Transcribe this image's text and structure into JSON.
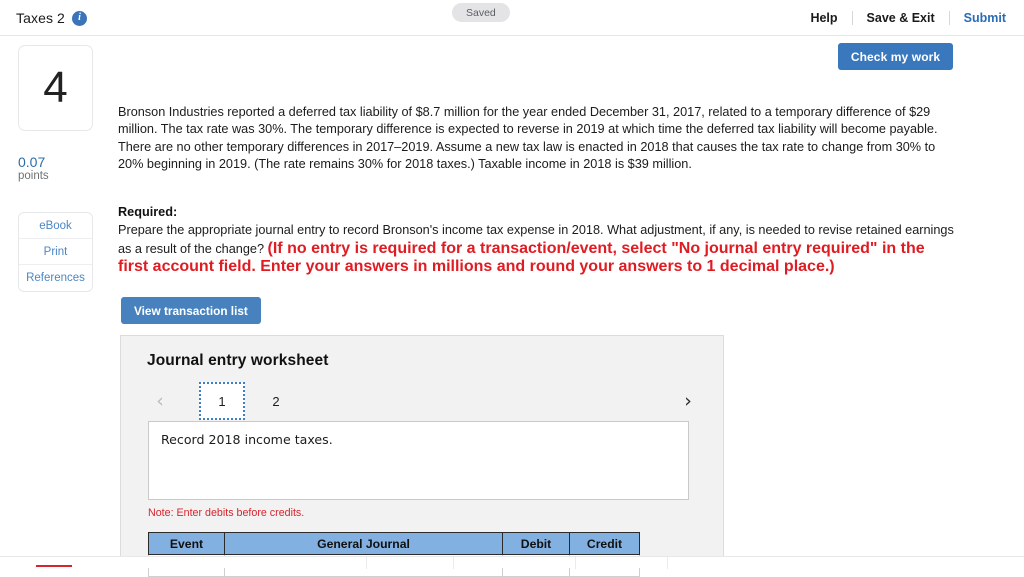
{
  "topbar": {
    "title": "Taxes 2",
    "info_icon": "info-icon",
    "status_pill": "Saved",
    "nav": [
      {
        "label": "Help",
        "style": "dark"
      },
      {
        "label": "Save & Exit",
        "style": "dark"
      },
      {
        "label": "Submit",
        "style": "blue"
      }
    ]
  },
  "actions": {
    "check_my_work": "Check my work",
    "view_transaction_list": "View transaction list"
  },
  "left_rail": {
    "question_number": "4",
    "points_value": "0.07",
    "points_label": "points",
    "buttons": [
      {
        "label": "eBook"
      },
      {
        "label": "Print"
      },
      {
        "label": "References"
      }
    ]
  },
  "question": {
    "body": "Bronson Industries reported a deferred tax liability of $8.7 million for the year ended December 31, 2017, related to a temporary difference of $29 million. The tax rate was 30%. The temporary difference is expected to reverse in 2019 at which time the deferred tax liability will become payable. There are no other temporary differences in 2017–2019. Assume a new tax law is enacted in 2018 that causes the tax rate to change from 30% to 20% beginning in 2019. (The rate remains 30% for 2018 taxes.) Taxable income in 2018 is $39 million.",
    "required_label": "Required:",
    "required_body": "Prepare the appropriate journal entry to record Bronson's income tax expense in 2018. What adjustment, if any, is needed to revise retained earnings as a result of the change? ",
    "required_emphasis": "(If no entry is required for a transaction/event, select \"No journal entry required\" in the first account field. Enter your answers in millions and round your answers to 1 decimal place.)"
  },
  "worksheet": {
    "title": "Journal entry worksheet",
    "prev_icon": "chevron-left-icon",
    "next_icon": "chevron-right-icon",
    "pages": [
      {
        "label": "1",
        "active": true
      },
      {
        "label": "2",
        "active": false
      }
    ],
    "description": "Record 2018 income taxes.",
    "note": "Note: Enter debits before credits.",
    "table": {
      "headers": [
        "Event",
        "General Journal",
        "Debit",
        "Credit"
      ],
      "rows": [
        [
          "",
          "",
          "",
          ""
        ]
      ]
    }
  },
  "colors": {
    "accent_blue": "#3a78bd",
    "link_blue": "#2b6cb8",
    "table_header_blue": "#82b0e0",
    "alert_red": "#e01c23",
    "panel_gray": "#f2f2f2"
  }
}
